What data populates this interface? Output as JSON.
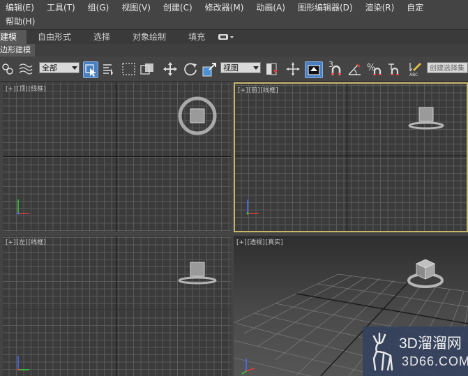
{
  "menubar": {
    "row1": [
      "编辑(E)",
      "工具(T)",
      "组(G)",
      "视图(V)",
      "创建(C)",
      "修改器(M)",
      "动画(A)",
      "图形编辑器(D)",
      "渲染(R)",
      "自定"
    ],
    "row2": [
      "帮助(H)"
    ]
  },
  "ribbon": {
    "tabs": [
      "建模",
      "自由形式",
      "选择",
      "对象绘制",
      "填充"
    ]
  },
  "subbar": {
    "label": "边形建模"
  },
  "toolbar": {
    "filter_value": "全部",
    "coord_value": "视图",
    "snap_num": "3",
    "named_selection_placeholder": "创建选择集"
  },
  "viewports": {
    "top": {
      "plus": "[+]",
      "view": "[顶]",
      "mode": "[线框]"
    },
    "front": {
      "plus": "[+]",
      "view": "[前]",
      "mode": "[线框]"
    },
    "left": {
      "plus": "[+]",
      "view": "[左]",
      "mode": "[线框]"
    },
    "persp": {
      "plus": "[+]",
      "view": "[透视]",
      "mode": "[真实]"
    }
  },
  "watermark": {
    "brand": "3D溜溜网",
    "url": "3D66.COM"
  },
  "colors": {
    "background": "#444444",
    "viewport": "#3b3b3b",
    "grid": "#5a5a5a",
    "active_border": "#c8b76a",
    "active_button": "#4a7fc0"
  }
}
